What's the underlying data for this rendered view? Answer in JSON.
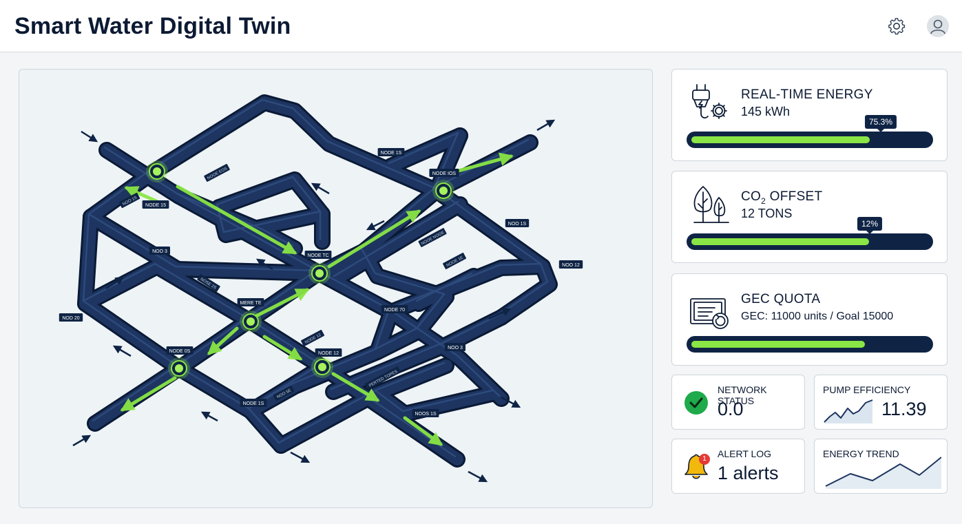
{
  "header": {
    "title": "Smart Water Digital Twin"
  },
  "icons": {
    "settings": "gear-icon",
    "profile": "user-avatar-icon"
  },
  "colors": {
    "accent": "#8ae644",
    "navy": "#0f2445",
    "alert": "#e53935",
    "success": "#1faa4b",
    "bell": "#f2b90c"
  },
  "network_map": {
    "node_labels": [
      "NODE 1S",
      "NODE IOS",
      "NODE 15",
      "NOO 3",
      "NODE TC",
      "MERE TE",
      "NODE 0S",
      "NODE 12",
      "NOD 20",
      "NODE 1S",
      "NODE 70",
      "NOO 3",
      "NOO 12",
      "NOOS 1S",
      "NOO 1S"
    ],
    "pipe_markings": [
      "NOOE EOS",
      "NOO 1S",
      "NOSE 2S",
      "NOOE NOOE",
      "NOOE 1E",
      "NODE 12",
      "PERTED TOPES",
      "NOO 5E"
    ]
  },
  "energy": {
    "label": "REAL-TIME ENERGY",
    "value": "145 kWh",
    "percent_label": "75.3%",
    "fill_fraction": 0.753
  },
  "co2": {
    "label_prefix": "CO",
    "label_sub": "2",
    "label_suffix": " OFFSET",
    "value": "12 TONS",
    "percent_label": "12%",
    "fill_fraction": 0.75
  },
  "gec": {
    "label": "GEC QUOTA",
    "value": "GEC: 11000 units / Goal 15000",
    "fill_fraction": 0.733
  },
  "network_status": {
    "label": "NETWORK STATUS",
    "value": "0.0"
  },
  "pump_efficiency": {
    "label": "PUMP EFFICIENCY",
    "value": "11.39"
  },
  "alert_log": {
    "label": "ALERT LOG",
    "value": "1 alerts",
    "badge": "1"
  },
  "energy_trend": {
    "label": "ENERGY TREND"
  }
}
